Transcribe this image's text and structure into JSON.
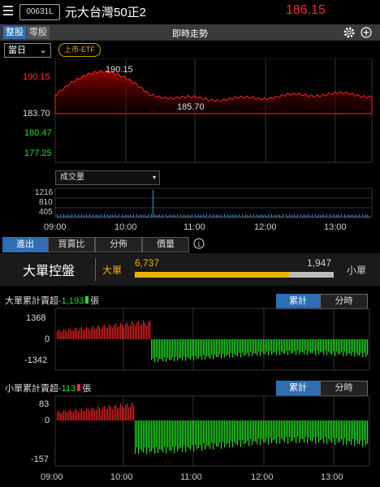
{
  "header": {
    "stock_code": "00631L",
    "stock_name": "元大台灣50正2",
    "price": "186.15"
  },
  "tabs": {
    "board": "整股",
    "odd": "零股"
  },
  "title": "即時走勢",
  "toolbar": {
    "settings_icon": "gear-icon",
    "add_icon": "plus-circle-icon"
  },
  "period": {
    "selected": "當日"
  },
  "market_badge": "上市-ETF",
  "price_chart": {
    "y_labels": {
      "high": "190.15",
      "ref": "183.70",
      "low1": "180.47",
      "low2": "177.25"
    },
    "annot_high": "190.15",
    "annot_low": "185.70"
  },
  "volume": {
    "selector": "成交量",
    "ticks": [
      "1216",
      "810",
      "405"
    ]
  },
  "x_ticks": [
    "09:00",
    "10:00",
    "11:00",
    "12:00",
    "13:00"
  ],
  "bottom_tabs": [
    "進出",
    "買賣比",
    "分佈",
    "價量"
  ],
  "info_icon": "info-icon",
  "control": {
    "title": "大單控盤",
    "big_label": "大單",
    "big_value": "6,737",
    "small_value": "1,947",
    "small_label": "小單",
    "big_share": 0.776
  },
  "large_order": {
    "label": "大單累計賣超",
    "value": "-1,193",
    "unit": "張",
    "seg_cum": "累計",
    "seg_time": "分時",
    "y_ticks": [
      "1368",
      "0",
      "-1342"
    ]
  },
  "small_order": {
    "label": "小單累計賣超",
    "value": "-113",
    "unit": "張",
    "seg_cum": "累計",
    "seg_time": "分時",
    "y_ticks": [
      "83",
      "0",
      "-157"
    ]
  },
  "bottom_x_ticks": [
    "09:00",
    "10:00",
    "11:00",
    "12:00",
    "13:00"
  ],
  "colors": {
    "up": "#ff2a2a",
    "down": "#22dd22",
    "accent": "#2f6db5",
    "bar": "#f0b400"
  }
}
